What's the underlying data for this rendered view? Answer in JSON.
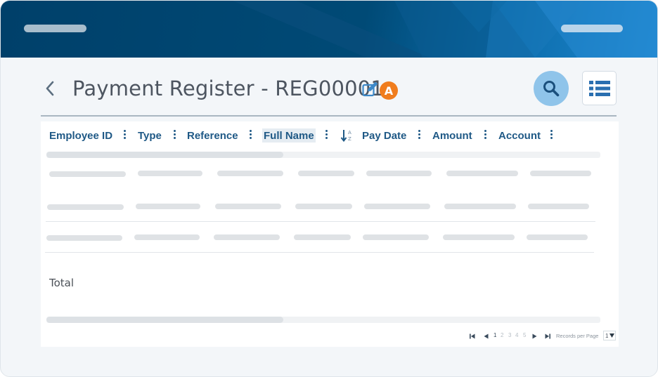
{
  "header": {
    "title": "Payment Register - REG00001",
    "badge": "A"
  },
  "grid": {
    "columns": [
      {
        "label": "Employee ID"
      },
      {
        "label": "Type"
      },
      {
        "label": "Reference"
      },
      {
        "label": "Full Name",
        "sorted": true
      },
      {
        "label": "Pay Date"
      },
      {
        "label": "Amount"
      },
      {
        "label": "Account"
      }
    ],
    "footer_label": "Total"
  },
  "pager": {
    "pages": [
      "1",
      "2",
      "3",
      "4",
      "5"
    ],
    "current_page": "1",
    "records_per_page_label": "Records per Page",
    "records_per_page_value": "1"
  },
  "colors": {
    "banner": "#00406a",
    "header_text": "#1f5986",
    "badge": "#f07d1e",
    "search_button": "#8fc4ea"
  },
  "icons": [
    "back-chevron-icon",
    "edit-icon",
    "search-icon",
    "list-view-icon",
    "column-menu-icon",
    "sort-ascending-icon",
    "first-page-icon",
    "previous-page-icon",
    "next-page-icon",
    "last-page-icon",
    "dropdown-caret-icon"
  ]
}
